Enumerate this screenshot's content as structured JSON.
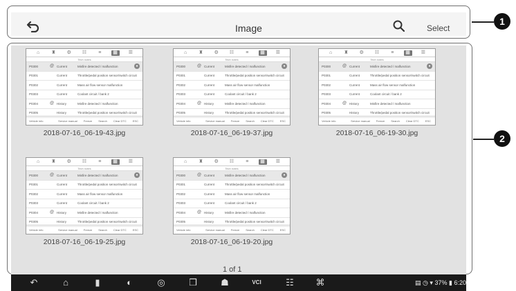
{
  "header": {
    "title": "Image",
    "select_label": "Select"
  },
  "callouts": [
    "1",
    "2"
  ],
  "thumb_ui": {
    "tabs": [
      "home",
      "vehicle",
      "settings",
      "car",
      "stats",
      "grid",
      "doc"
    ],
    "active_tab_index": 5,
    "subtitle": "Tech notes",
    "footer": {
      "info": "Vehicle info",
      "buttons": [
        "Service manual",
        "Freeze",
        "Search",
        "Clear DTC",
        "ESC"
      ]
    },
    "rows": [
      {
        "code": "P0300",
        "flag": "@",
        "status": "Current",
        "desc": "Misfire detected / malfunction",
        "hl": true
      },
      {
        "code": "P0301",
        "flag": "",
        "status": "Current",
        "desc": "Throttle/pedal position sensor/switch circuit",
        "hl": false
      },
      {
        "code": "P0302",
        "flag": "",
        "status": "Current",
        "desc": "Mass air flow sensor malfunction",
        "hl": false
      },
      {
        "code": "P0303",
        "flag": "",
        "status": "Current",
        "desc": "Coolant circuit / bank 2",
        "hl": false
      },
      {
        "code": "P0304",
        "flag": "@",
        "status": "History",
        "desc": "Misfire detected / malfunction",
        "hl": false
      },
      {
        "code": "P0305",
        "flag": "",
        "status": "History",
        "desc": "Throttle/pedal position sensor/switch circuit",
        "hl": false
      }
    ]
  },
  "images": [
    {
      "filename": "2018-07-16_06-19-43.jpg"
    },
    {
      "filename": "2018-07-16_06-19-37.jpg"
    },
    {
      "filename": "2018-07-16_06-19-30.jpg"
    },
    {
      "filename": "2018-07-16_06-19-25.jpg"
    },
    {
      "filename": "2018-07-16_06-19-20.jpg"
    }
  ],
  "pagination": {
    "label": "1 of 1"
  },
  "system_nav": {
    "icons": [
      "back-icon",
      "home-icon",
      "recents-icon",
      "browser-icon",
      "camera-icon",
      "screenshot-icon",
      "shop-icon",
      "vci-icon",
      "car-icon",
      "remote-desk-icon"
    ],
    "vci_label": "VCI",
    "status": {
      "battery": "37%",
      "time": "6:20"
    }
  }
}
